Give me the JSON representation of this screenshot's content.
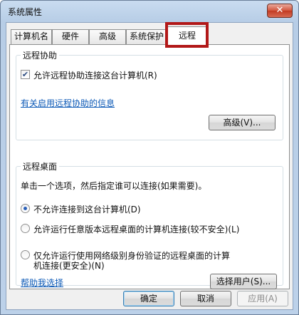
{
  "window": {
    "title": "系统属性",
    "close_label": "✕"
  },
  "tabs": [
    {
      "label": "计算机名"
    },
    {
      "label": "硬件"
    },
    {
      "label": "高级"
    },
    {
      "label": "系统保护"
    },
    {
      "label": "远程"
    }
  ],
  "remote_assistance": {
    "group_label": "远程协助",
    "checkbox_label": "允许远程协助连接这台计算机(R)",
    "checked": true,
    "info_link": "有关启用远程协助的信息",
    "advanced_button": "高级(V)..."
  },
  "remote_desktop": {
    "group_label": "远程桌面",
    "description": "单击一个选项，然后指定谁可以连接(如果需要)。",
    "options": [
      {
        "label": "不允许连接到这台计算机(D)",
        "selected": true
      },
      {
        "label": "允许运行任意版本远程桌面的计算机连接(较不安全)(L)",
        "selected": false
      },
      {
        "label_line1": "仅允许运行使用网络级别身份验证的远程桌面的计算",
        "label_line2": "机连接(更安全)(N)",
        "selected": false
      }
    ],
    "help_link": "帮助我选择",
    "select_users_button": "选择用户(S)..."
  },
  "footer": {
    "ok": "确定",
    "cancel": "取消",
    "apply": "应用(A)"
  },
  "colors": {
    "highlight": "#b21818",
    "link": "#0d5ab7"
  }
}
